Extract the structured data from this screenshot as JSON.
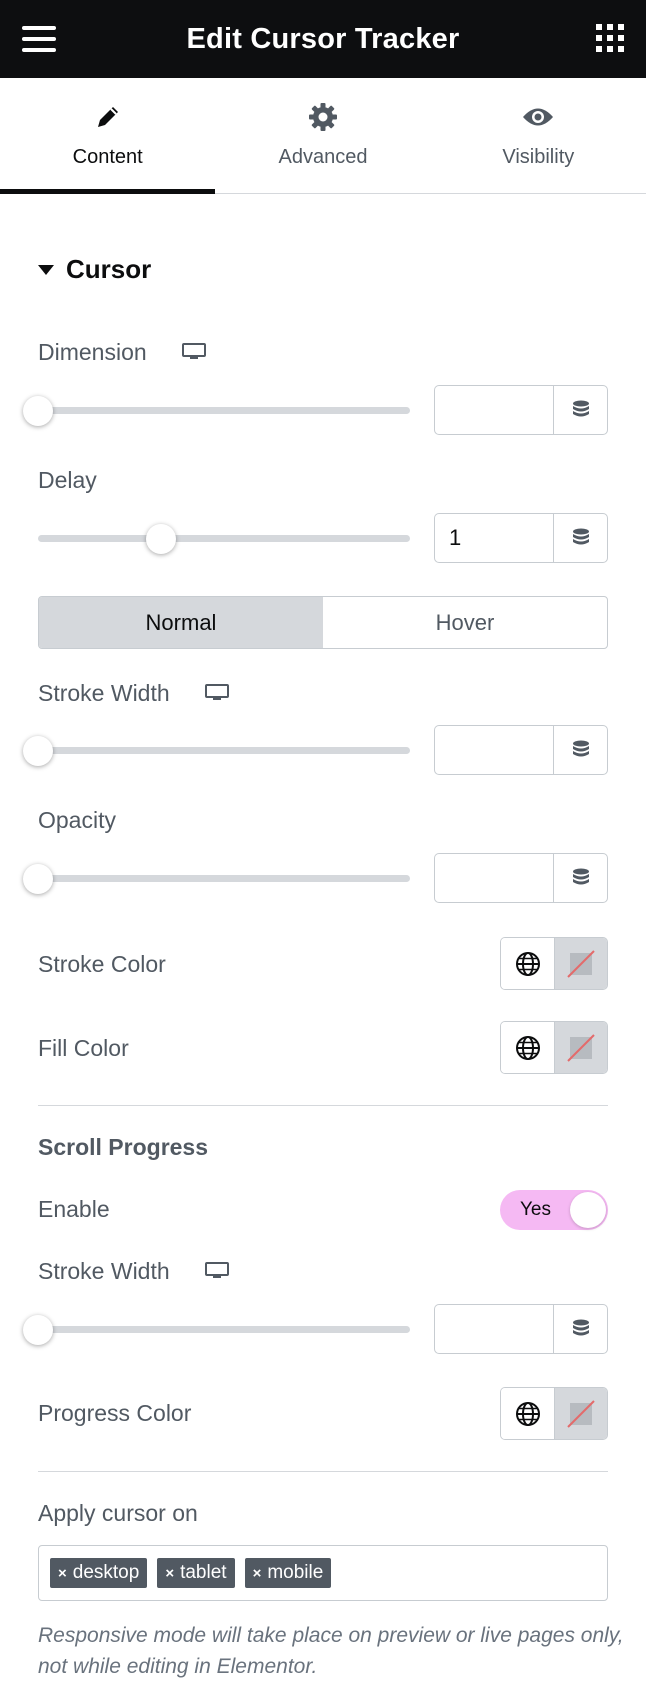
{
  "header": {
    "title": "Edit Cursor Tracker"
  },
  "tabs": [
    {
      "label": "Content",
      "icon": "pencil-icon",
      "active": true
    },
    {
      "label": "Advanced",
      "icon": "gear-icon",
      "active": false
    },
    {
      "label": "Visibility",
      "icon": "eye-icon",
      "active": false
    }
  ],
  "cursor_section": {
    "title": "Cursor",
    "dimension": {
      "label": "Dimension",
      "value": "",
      "slider_fraction": 0
    },
    "delay": {
      "label": "Delay",
      "value": "1",
      "slider_fraction": 0.333
    },
    "state_tabs": {
      "normal": "Normal",
      "hover": "Hover",
      "active": "Normal"
    },
    "stroke_width": {
      "label": "Stroke Width",
      "value": "",
      "slider_fraction": 0
    },
    "opacity": {
      "label": "Opacity",
      "value": "",
      "slider_fraction": 0
    },
    "stroke_color": {
      "label": "Stroke Color"
    },
    "fill_color": {
      "label": "Fill Color"
    }
  },
  "scroll_progress": {
    "title": "Scroll Progress",
    "enable": {
      "label": "Enable",
      "toggle_text": "Yes",
      "on": true
    },
    "stroke_width": {
      "label": "Stroke Width",
      "value": "",
      "slider_fraction": 0
    },
    "progress_color": {
      "label": "Progress Color"
    }
  },
  "apply_cursor": {
    "label": "Apply cursor on",
    "tags": [
      "desktop",
      "tablet",
      "mobile"
    ],
    "note": "Responsive mode will take place on preview or live pages only, not while editing in Elementor."
  },
  "colors": {
    "accent_toggle": "#f5b9f3",
    "header_bg": "#0d0e10",
    "text": "#515962"
  }
}
